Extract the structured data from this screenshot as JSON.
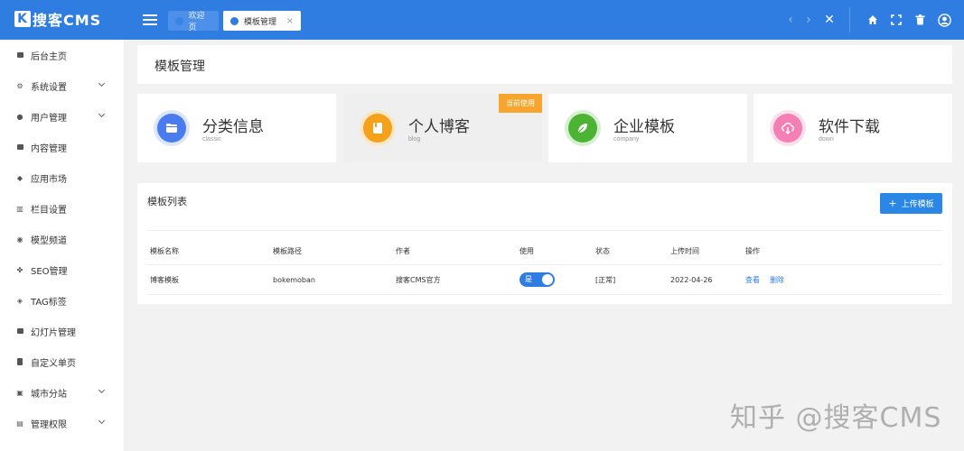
{
  "header": {
    "logo_text": "搜客CMS",
    "logo_mark": "K",
    "tabs": [
      {
        "label": "欢迎页"
      },
      {
        "label": "模板管理",
        "close": "×"
      }
    ],
    "buttons": {
      "prev": "‹",
      "next": "›",
      "close_all": "✕",
      "home": "⌂",
      "fullscreen": "⛶",
      "clear": "🗑",
      "user": "◉"
    }
  },
  "sidebar": {
    "items": [
      {
        "label": "后台主页",
        "icon": "monitor-icon"
      },
      {
        "label": "系统设置",
        "icon": "gear-icon",
        "expandable": true
      },
      {
        "label": "用户管理",
        "icon": "user-icon",
        "expandable": true
      },
      {
        "label": "内容管理",
        "icon": "document-icon"
      },
      {
        "label": "应用市场",
        "icon": "cube-icon"
      },
      {
        "label": "栏目设置",
        "icon": "columns-icon"
      },
      {
        "label": "模型频道",
        "icon": "circle-icon"
      },
      {
        "label": "SEO管理",
        "icon": "paw-icon"
      },
      {
        "label": "TAG标签",
        "icon": "tag-icon"
      },
      {
        "label": "幻灯片管理",
        "icon": "slides-icon"
      },
      {
        "label": "自定义单页",
        "icon": "page-icon"
      },
      {
        "label": "城市分站",
        "icon": "city-icon",
        "expandable": true
      },
      {
        "label": "管理权限",
        "icon": "shield-icon",
        "expandable": true
      }
    ]
  },
  "main": {
    "page_title": "模板管理",
    "categories": [
      {
        "title": "分类信息",
        "subtitle": "classic",
        "color": "#4a7bef",
        "ring": "#dbe5fb",
        "icon": "folder-icon"
      },
      {
        "title": "个人博客",
        "subtitle": "blog",
        "color": "#f5a11c",
        "ring": "#fbe7c6",
        "icon": "book-icon",
        "badge": "当前使用"
      },
      {
        "title": "企业模板",
        "subtitle": "company",
        "color": "#4db335",
        "ring": "#d6efd0",
        "icon": "leaf-icon"
      },
      {
        "title": "软件下载",
        "subtitle": "down",
        "color": "#f47fb4",
        "ring": "#fce0ec",
        "icon": "cloud-download-icon"
      }
    ],
    "list": {
      "title": "模板列表",
      "upload_label": "上传模板",
      "columns": [
        "模板名称",
        "模板路径",
        "作者",
        "使用",
        "状态",
        "上传时间",
        "操作"
      ],
      "rows": [
        {
          "name": "博客模板",
          "path": "bokemoban",
          "author": "搜客CMS官方",
          "use": "是",
          "status": "[正常]",
          "upload_time": "2022-04-26",
          "action_view": "查看",
          "action_delete": "删除"
        }
      ]
    }
  },
  "watermark": "知乎 @搜客CMS"
}
